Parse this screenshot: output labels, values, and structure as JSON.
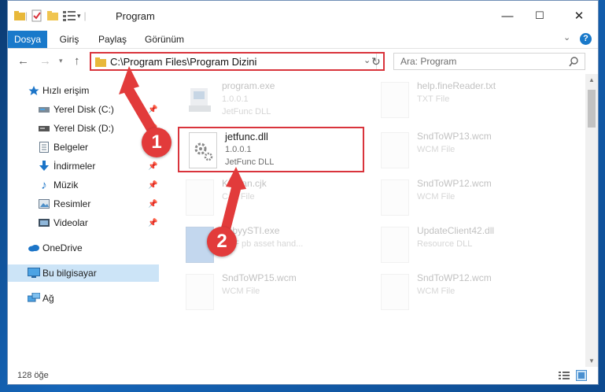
{
  "window": {
    "title": "Program",
    "controls": {
      "minimize": "—",
      "maximize": "☐",
      "close": "✕"
    }
  },
  "ribbon": {
    "tabs": [
      "Dosya",
      "Giriş",
      "Paylaş",
      "Görünüm"
    ]
  },
  "address": {
    "path": "C:\\Program Files\\Program Dizini",
    "search_placeholder": "Ara: Program"
  },
  "sidebar": {
    "items": [
      {
        "label": "Hızlı erişim",
        "icon": "star-icon"
      },
      {
        "label": "Yerel Disk (C:)",
        "icon": "drive-icon",
        "pinned": true
      },
      {
        "label": "Yerel Disk (D:)",
        "icon": "drive-icon",
        "pinned": true
      },
      {
        "label": "Belgeler",
        "icon": "document-icon",
        "pinned": true
      },
      {
        "label": "İndirmeler",
        "icon": "download-icon",
        "pinned": true
      },
      {
        "label": "Müzik",
        "icon": "music-icon",
        "pinned": true
      },
      {
        "label": "Resimler",
        "icon": "pictures-icon",
        "pinned": true
      },
      {
        "label": "Videolar",
        "icon": "video-icon",
        "pinned": true
      },
      {
        "label": "OneDrive",
        "icon": "cloud-icon"
      },
      {
        "label": "Bu bilgisayar",
        "icon": "computer-icon",
        "selected": true
      },
      {
        "label": "Ağ",
        "icon": "network-icon"
      }
    ]
  },
  "files": [
    {
      "name": "program.exe",
      "line2": "1.0.0.1",
      "line3": "JetFunc DLL",
      "faded": true
    },
    {
      "name": "help.fineReader.txt",
      "line2": "TXT File",
      "line3": "",
      "faded": true
    },
    {
      "name": "jetfunc.dll",
      "line2": "1.0.0.1",
      "line3": "JetFunc DLL",
      "faded": false
    },
    {
      "name": "SndToWP13.wcm",
      "line2": "WCM File",
      "line3": "",
      "faded": true
    },
    {
      "name": "Korean.cjk",
      "line2": "CJK File",
      "line3": "",
      "faded": true
    },
    {
      "name": "SndToWP12.wcm",
      "line2": "WCM File",
      "line3": "",
      "faded": true
    },
    {
      "name": "abbyySTI.exe",
      "line2": "SDF pb asset hand...",
      "line3": "",
      "faded": true
    },
    {
      "name": "UpdateClient42.dll",
      "line2": "Resource DLL",
      "line3": "",
      "faded": true
    },
    {
      "name": "SndToWP15.wcm",
      "line2": "WCM File",
      "line3": "",
      "faded": true
    },
    {
      "name": "SndToWP12.wcm",
      "line2": "WCM File",
      "line3": "",
      "faded": true
    }
  ],
  "status": {
    "count": "128 öğe"
  },
  "annotations": {
    "step1": "1",
    "step2": "2"
  },
  "colors": {
    "accent": "#1979ca",
    "highlight": "#d9343c",
    "selection": "#cce4f7"
  }
}
